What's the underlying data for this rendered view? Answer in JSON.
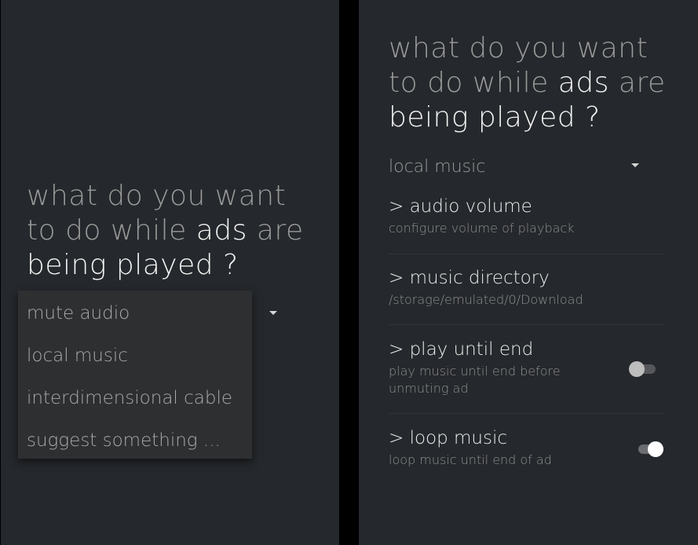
{
  "question": {
    "part1": "what do you want to do while ",
    "highlight1": "ads",
    "part2": " are ",
    "highlight2": "being played ?"
  },
  "dropdown": {
    "options": [
      "mute audio",
      "local music",
      "interdimensional cable",
      "suggest something ..."
    ],
    "selected": "local music"
  },
  "settings": [
    {
      "title": "> audio volume",
      "subtitle": "configure volume of playback"
    },
    {
      "title": "> music directory",
      "subtitle": "/storage/emulated/0/Download"
    },
    {
      "title": "> play until end",
      "subtitle": "play music until end before unmuting ad",
      "toggle": false
    },
    {
      "title": "> loop music",
      "subtitle": "loop music until end of ad",
      "toggle": true
    }
  ],
  "colors": {
    "background": "#25282c",
    "menu": "#2e2f31",
    "text_dim": "#9a9a9a",
    "text_bright": "#f2f2f2"
  }
}
